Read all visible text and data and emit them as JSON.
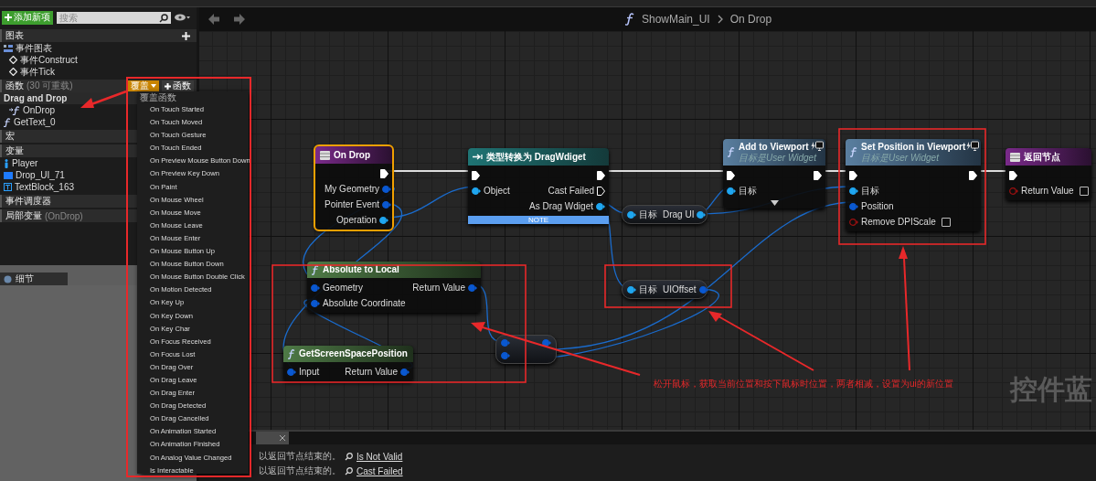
{
  "sidebar": {
    "add_button": "添加新项",
    "search": {
      "placeholder": "搜索"
    },
    "sections": [
      {
        "label": "图表",
        "buttons": [
          {
            "kind": "add_icon",
            "selected": false
          }
        ],
        "items": [
          {
            "label": "事件图表",
            "kind": "graph",
            "children": [
              {
                "label": "事件Construct",
                "kind": "event"
              },
              {
                "label": "事件Tick",
                "kind": "event"
              }
            ]
          }
        ]
      },
      {
        "label": "函数",
        "note": "(30 可重载)",
        "buttons": [
          {
            "kind": "dropdown",
            "label": "覆盖",
            "selected": true
          },
          {
            "kind": "add",
            "label": "函数",
            "selected": false
          }
        ],
        "items": [
          {
            "label": "Drag and Drop",
            "kind": "category",
            "children": [
              {
                "label": "OnDrop",
                "kind": "override"
              }
            ]
          },
          {
            "label": "GetText_0",
            "kind": "function"
          }
        ]
      },
      {
        "label": "宏"
      },
      {
        "label": "变量",
        "items": [
          {
            "label": "Player",
            "kind": "pawn"
          },
          {
            "label": "Drop_UI_71",
            "kind": "widget"
          },
          {
            "label": "TextBlock_163",
            "kind": "text"
          }
        ]
      },
      {
        "label": "事件调度器"
      },
      {
        "label": "局部变量",
        "note": "(OnDrop)"
      }
    ]
  },
  "details_panel": {
    "title": "细节"
  },
  "menu": {
    "title": "覆盖函数",
    "items": [
      "On Touch Started",
      "On Touch Moved",
      "On Touch Gesture",
      "On Touch Ended",
      "On Preview Mouse Button Down",
      "On Preview Key Down",
      "On Paint",
      "On Mouse Wheel",
      "On Mouse Move",
      "On Mouse Leave",
      "On Mouse Enter",
      "On Mouse Button Up",
      "On Mouse Button Down",
      "On Mouse Button Double Click",
      "On Motion Detected",
      "On Key Up",
      "On Key Down",
      "On Key Char",
      "On Focus Received",
      "On Focus Lost",
      "On Drag Over",
      "On Drag Leave",
      "On Drag Enter",
      "On Drag Detected",
      "On Drag Cancelled",
      "On Animation Started",
      "On Animation Finished",
      "On Analog Value Changed",
      "Is Interactable"
    ]
  },
  "graph": {
    "breadcrumb": [
      "ShowMain_UI",
      "On Drop"
    ],
    "corner_label": "控件蓝",
    "nodes": [
      {
        "kind": "event",
        "title": "On Drop",
        "selected": true,
        "client_only": false,
        "advanced": false,
        "outputs": [
          {
            "kind": "exec"
          },
          {
            "kind": "struct",
            "label": "My Geometry"
          },
          {
            "kind": "struct",
            "label": "Pointer Event"
          },
          {
            "kind": "object",
            "label": "Operation"
          }
        ]
      },
      {
        "kind": "cast",
        "title": "类型转换为 DragWdiget",
        "selected": false,
        "client_only": false,
        "advanced": false,
        "footer": "NOTE",
        "inputs": [
          {
            "kind": "exec"
          },
          {
            "kind": "object",
            "label": "Object"
          }
        ],
        "outputs": [
          {
            "kind": "exec"
          },
          {
            "kind": "exec_open",
            "label": "Cast Failed"
          },
          {
            "kind": "object",
            "label": "As Drag Wdiget"
          }
        ]
      },
      {
        "kind": "getter",
        "selected": false,
        "client_only": false,
        "advanced": false,
        "inputs": [
          {
            "kind": "object",
            "label": "目标"
          }
        ],
        "outputs": [
          {
            "kind": "object",
            "label": "Drag UI"
          }
        ]
      },
      {
        "kind": "function",
        "title": "Add to Viewport",
        "subtitle": "目标是User Widget",
        "selected": false,
        "client_only": true,
        "advanced": true,
        "inputs": [
          {
            "kind": "exec"
          },
          {
            "kind": "object",
            "label": "目标"
          }
        ],
        "outputs": [
          {
            "kind": "exec"
          }
        ]
      },
      {
        "kind": "function",
        "title": "Set Position in Viewport",
        "subtitle": "目标是User Widget",
        "selected": false,
        "client_only": true,
        "advanced": false,
        "inputs": [
          {
            "kind": "exec"
          },
          {
            "kind": "object",
            "label": "目标"
          },
          {
            "kind": "struct",
            "label": "Position"
          },
          {
            "kind": "bool",
            "label": "Remove DPIScale",
            "checked": false
          }
        ],
        "outputs": [
          {
            "kind": "exec"
          }
        ]
      },
      {
        "kind": "return",
        "title": "返回节点",
        "selected": false,
        "client_only": false,
        "advanced": false,
        "inputs": [
          {
            "kind": "exec"
          },
          {
            "kind": "bool",
            "label": "Return Value",
            "checked": false
          }
        ]
      },
      {
        "kind": "pure",
        "title": "Absolute to Local",
        "selected": false,
        "client_only": false,
        "advanced": false,
        "inputs": [
          {
            "kind": "struct",
            "label": "Geometry"
          },
          {
            "kind": "struct",
            "label": "Absolute Coordinate"
          }
        ],
        "outputs": [
          {
            "kind": "struct",
            "label": "Return Value"
          }
        ]
      },
      {
        "kind": "getter",
        "selected": false,
        "client_only": false,
        "advanced": false,
        "inputs": [
          {
            "kind": "object",
            "label": "目标"
          }
        ],
        "outputs": [
          {
            "kind": "struct",
            "label": "UIOffset"
          }
        ]
      },
      {
        "kind": "pure",
        "title": "GetScreenSpacePosition",
        "selected": false,
        "client_only": false,
        "advanced": false,
        "inputs": [
          {
            "kind": "struct",
            "label": "Input"
          }
        ],
        "outputs": [
          {
            "kind": "struct",
            "label": "Return Value"
          }
        ]
      },
      {
        "kind": "operator",
        "selected": false,
        "client_only": false,
        "advanced": false,
        "inputs": [
          {
            "kind": "struct"
          },
          {
            "kind": "struct"
          }
        ],
        "outputs": [
          {
            "kind": "struct"
          }
        ]
      }
    ],
    "annotation": "松开鼠标，获取当前位置和按下鼠标时位置，两者相减，设置为ui的新位置"
  },
  "results": {
    "lines": [
      {
        "text": "以返回节点结束的。",
        "link": "Is Not Valid"
      },
      {
        "text": "以返回节点结束的。",
        "link": "Cast Failed"
      }
    ]
  }
}
